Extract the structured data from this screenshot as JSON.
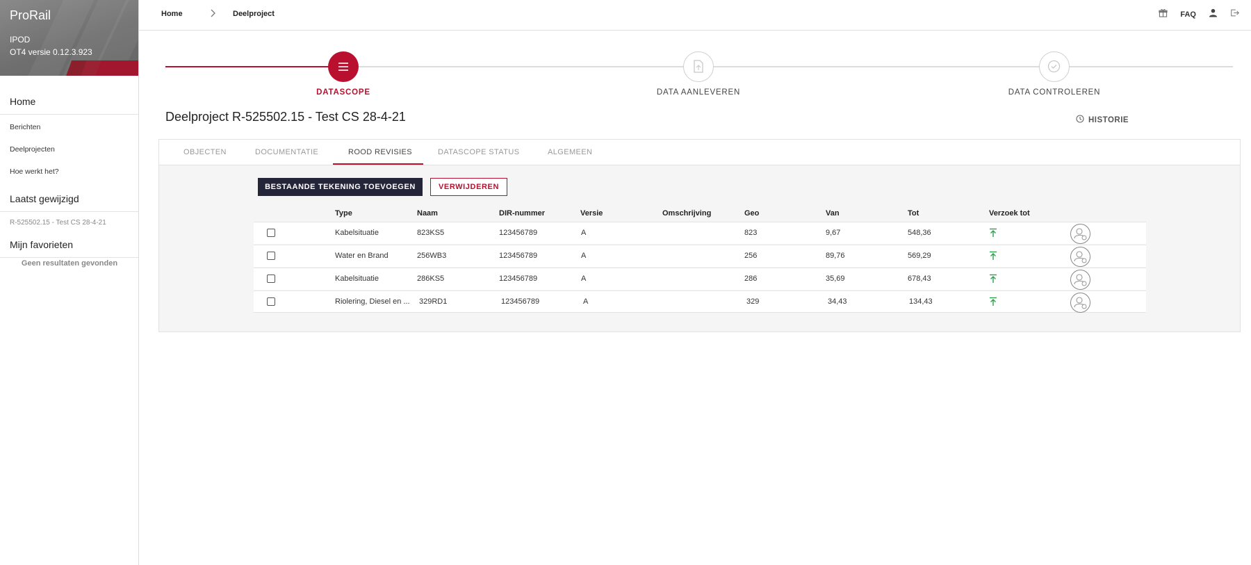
{
  "sidebar": {
    "brand": "ProRail",
    "app_name": "IPOD",
    "version": "OT4 versie 0.12.3.923",
    "home": "Home",
    "links": [
      "Berichten",
      "Deelprojecten",
      "Hoe werkt het?"
    ],
    "recent_title": "Laatst gewijzigd",
    "recent_item": "R-525502.15 - Test CS 28-4-21",
    "favorites_title": "Mijn favorieten",
    "favorites_empty": "Geen resultaten gevonden"
  },
  "header": {
    "breadcrumb": [
      "Home",
      "Deelproject"
    ],
    "faq": "FAQ",
    "icons": [
      "gift-icon",
      "user-icon",
      "logout-icon"
    ]
  },
  "stepper": {
    "steps": [
      {
        "label": "DATASCOPE",
        "state": "active",
        "icon": "list-icon"
      },
      {
        "label": "DATA AANLEVEREN",
        "state": "inactive",
        "icon": "document-icon"
      },
      {
        "label": "DATA CONTROLEREN",
        "state": "inactive",
        "icon": "check-circle-icon"
      }
    ]
  },
  "page": {
    "title": "Deelproject R-525502.15 - Test CS 28-4-21",
    "historie": "HISTORIE"
  },
  "tabs": [
    "OBJECTEN",
    "DOCUMENTATIE",
    "ROOD REVISIES",
    "DATASCOPE STATUS",
    "ALGEMEEN"
  ],
  "active_tab": "ROOD REVISIES",
  "actions": {
    "add_existing": "BESTAANDE TEKENING TOEVOEGEN",
    "delete": "VERWIJDEREN"
  },
  "table": {
    "columns": [
      "Type",
      "Naam",
      "DIR-nummer",
      "Versie",
      "Omschrijving",
      "Geo",
      "Van",
      "Tot",
      "Verzoek tot"
    ],
    "rows": [
      {
        "type": "Kabelsituatie",
        "naam": "823KS5",
        "dir": "123456789",
        "versie": "A",
        "omschrijving": "",
        "geo": "823",
        "van": "9,67",
        "tot": "548,36"
      },
      {
        "type": "Water en Brand",
        "naam": "256WB3",
        "dir": "123456789",
        "versie": "A",
        "omschrijving": "",
        "geo": "256",
        "van": "89,76",
        "tot": "569,29"
      },
      {
        "type": "Kabelsituatie",
        "naam": "286KS5",
        "dir": "123456789",
        "versie": "A",
        "omschrijving": "",
        "geo": "286",
        "van": "35,69",
        "tot": "678,43"
      },
      {
        "type": "Riolering, Diesel en ...",
        "naam": "329RD1",
        "dir": "123456789",
        "versie": "A",
        "omschrijving": "",
        "geo": "329",
        "van": "34,43",
        "tot": "134,43"
      }
    ]
  },
  "colors": {
    "accent": "#b8102e",
    "dark_button": "#25253a",
    "arrow_green": "#2e9e4f"
  }
}
